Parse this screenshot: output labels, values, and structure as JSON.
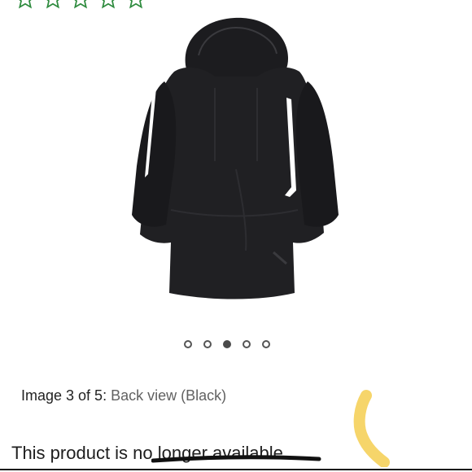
{
  "rating": {
    "star_count": 5,
    "star_color": "#2e8b3e"
  },
  "product": {
    "image_icon": "jacket-back-view-image",
    "jacket_color": "#1f1f22",
    "stripe_color": "#ffffff"
  },
  "carousel": {
    "total_images": 5,
    "active_index": 3
  },
  "caption": {
    "label": "Image 3 of 5:",
    "description": "Back view (Black)"
  },
  "notice": {
    "text": "This product is no longer available"
  },
  "colors": {
    "highlighter": "#f6d56a",
    "rule": "#1a1a1a"
  }
}
